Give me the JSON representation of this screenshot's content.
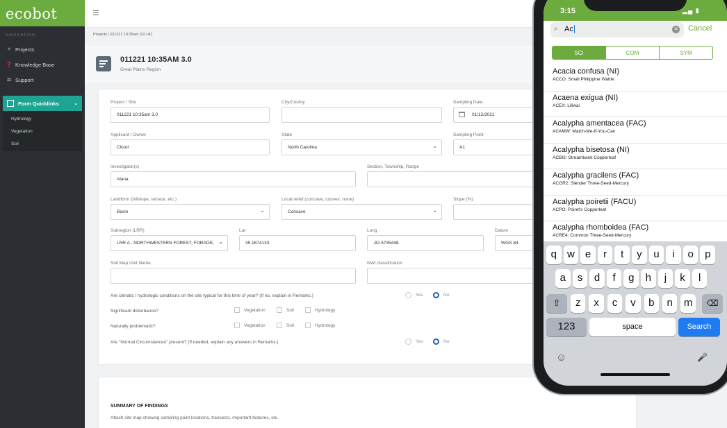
{
  "sidebar": {
    "logo": "ecobot",
    "nav_heading": "NAVIGATION",
    "items": [
      {
        "label": "Projects"
      },
      {
        "label": "Knowledge Base"
      },
      {
        "label": "Support"
      }
    ],
    "quicklinks": {
      "label": "Form Quicklinks",
      "items": [
        "Hydrology",
        "Vegetation",
        "Soil"
      ]
    }
  },
  "breadcrumb": "Projects  /  011221 10:35am 3.0  /  A1",
  "header": {
    "title": "011221 10:35AM 3.0",
    "region": "Great Plains Region"
  },
  "form": {
    "project_site": {
      "label": "Project / Site",
      "value": "011221 10:35am 3.0"
    },
    "city_county": {
      "label": "City/County",
      "value": ""
    },
    "sampling_date": {
      "label": "Sampling Date",
      "value": "01/12/2021"
    },
    "applicant": {
      "label": "Applicant / Owner",
      "value": "Cloud"
    },
    "state": {
      "label": "State",
      "value": "North Carolina"
    },
    "sampling_point": {
      "label": "Sampling Point",
      "value": "A1"
    },
    "investigator": {
      "label": "Investigator(s)",
      "value": "Alana"
    },
    "section": {
      "label": "Section, Township, Range",
      "value": ""
    },
    "landform": {
      "label": "Landform (hillslope, terrace, etc.)",
      "value": "Basin"
    },
    "local_relief": {
      "label": "Local relief (concave, convex, none)",
      "value": "Concave"
    },
    "slope": {
      "label": "Slope (%)",
      "value": ""
    },
    "subregion": {
      "label": "Subregion (LRR)",
      "value": "LRR A - NORTHWESTERN FOREST, FORAGE,"
    },
    "lat": {
      "label": "Lat",
      "value": "35.1674133"
    },
    "long": {
      "label": "Long",
      "value": "-82.5735448"
    },
    "datum": {
      "label": "Datum",
      "value": "WGS 84"
    },
    "soil_map": {
      "label": "Soil Map Unit Name",
      "value": ""
    },
    "nwi": {
      "label": "NWI classification",
      "value": ""
    },
    "q_climatic": "Are climatic / hydrologic conditions on the site typical for this time of year? (If no, explain in Remarks.)",
    "q_disturbance": "Significant disturbance?",
    "q_problematic": "Naturally problematic?",
    "q_normal": "Are \"Normal Circumstances\" present? (If needed, explain any answers in Remarks.)",
    "yes": "Yes",
    "no": "No",
    "vegetation": "Vegetation",
    "soil": "Soil",
    "hydrology": "Hydrology"
  },
  "summary": {
    "title": "SUMMARY OF FINDINGS",
    "subtitle": "Attach site map showing sampling point locations, transects, important features, etc."
  },
  "phone": {
    "time": "3:15",
    "search_value": "Ac",
    "cancel": "Cancel",
    "segments": [
      "SCI",
      "COM",
      "SYM"
    ],
    "results": [
      {
        "name": "Acacia confusa (NI)",
        "code": "ACCO: Small Philippine Wattle"
      },
      {
        "name": "Acaena exigua (NI)",
        "code": "ACEX: Liliwai"
      },
      {
        "name": "Acalypha amentacea (FAC)",
        "code": "ACAMW: Match-Me-If-You-Can"
      },
      {
        "name": "Acalypha bisetosa (NI)",
        "code": "ACBI3: Streambank Copperleaf"
      },
      {
        "name": "Acalypha gracilens (FAC)",
        "code": "ACGR2: Slender Three-Seed-Mercury"
      },
      {
        "name": "Acalypha poiretii (FACU)",
        "code": "ACPO: Poiret's Copperleaf"
      },
      {
        "name": "Acalypha rhomboidea (FAC)",
        "code": "ACRE4: Common Three-Seed-Mercury"
      }
    ],
    "keyboard": {
      "row1": [
        "q",
        "w",
        "e",
        "r",
        "t",
        "y",
        "u",
        "i",
        "o",
        "p"
      ],
      "row2": [
        "a",
        "s",
        "d",
        "f",
        "g",
        "h",
        "j",
        "k",
        "l"
      ],
      "row3": [
        "z",
        "x",
        "c",
        "v",
        "b",
        "n",
        "m"
      ],
      "num": "123",
      "space": "space",
      "search": "Search"
    }
  },
  "colors": {
    "brand_green": "#6cab3d",
    "teal": "#1fa393",
    "sidebar": "#2b2f33",
    "radio_blue": "#1c5fb5"
  }
}
